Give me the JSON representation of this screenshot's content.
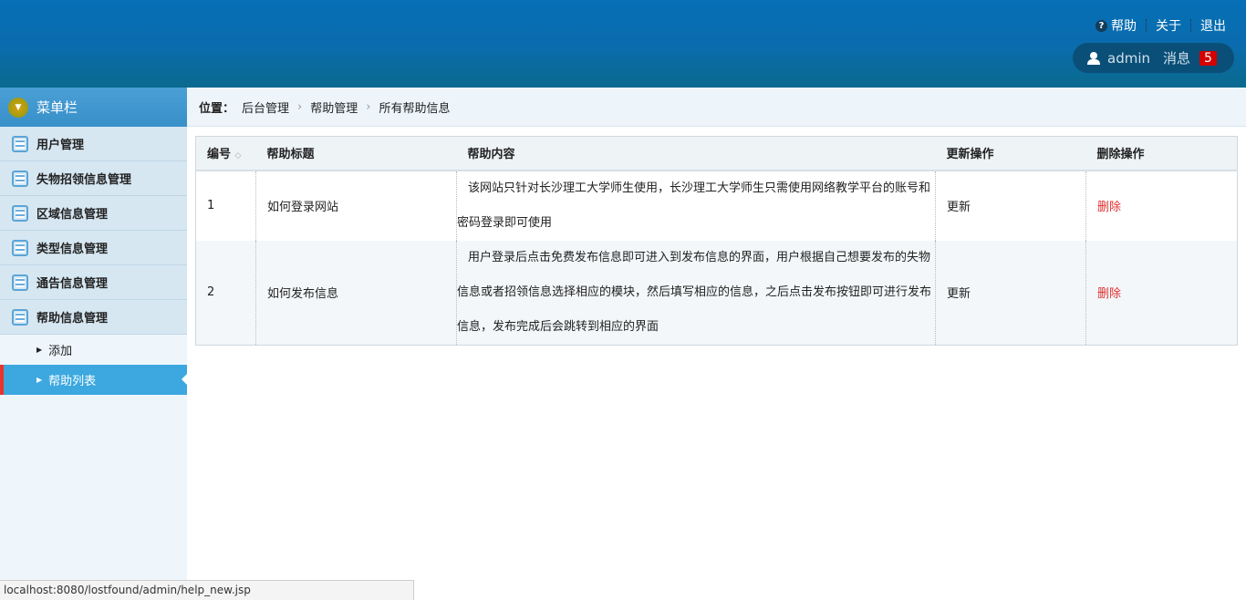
{
  "header": {
    "help": "帮助",
    "about": "关于",
    "logout": "退出",
    "user": "admin",
    "messages": "消息",
    "message_count": "5"
  },
  "sidebar": {
    "title": "菜单栏",
    "items": [
      {
        "label": "用户管理"
      },
      {
        "label": "失物招领信息管理"
      },
      {
        "label": "区域信息管理"
      },
      {
        "label": "类型信息管理"
      },
      {
        "label": "通告信息管理"
      },
      {
        "label": "帮助信息管理"
      }
    ],
    "subitems": [
      {
        "label": "添加"
      },
      {
        "label": "帮助列表"
      }
    ]
  },
  "breadcrumb": {
    "label": "位置：",
    "items": [
      "后台管理",
      "帮助管理",
      "所有帮助信息"
    ]
  },
  "table": {
    "headers": [
      "编号",
      "帮助标题",
      "帮助内容",
      "更新操作",
      "删除操作"
    ],
    "rows": [
      {
        "id": "1",
        "title": "如何登录网站",
        "content": "该网站只针对长沙理工大学师生使用，长沙理工大学师生只需使用网络教学平台的账号和密码登录即可使用",
        "update": "更新",
        "delete": "删除"
      },
      {
        "id": "2",
        "title": "如何发布信息",
        "content": "用户登录后点击免费发布信息即可进入到发布信息的界面，用户根据自己想要发布的失物信息或者招领信息选择相应的模块，然后填写相应的信息，之后点击发布按钮即可进行发布信息，发布完成后会跳转到相应的界面",
        "update": "更新",
        "delete": "删除"
      }
    ]
  },
  "statusbar": {
    "url": "localhost:8080/lostfound/admin/help_new.jsp"
  }
}
